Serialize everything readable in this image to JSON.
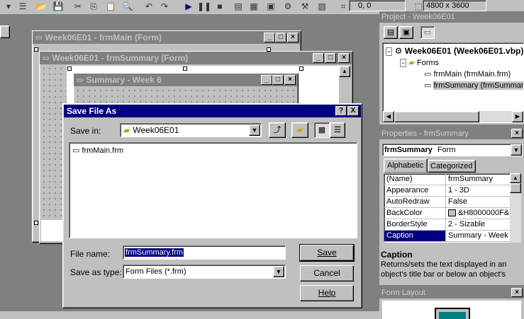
{
  "toolbar": {
    "coords": "0, 0",
    "size": "4800 x 3600"
  },
  "forms": {
    "main_title": "Week06E01 - frmMain (Form)",
    "summary_title": "Week06E01 - frmSummary (Form)",
    "inner_title": "Summary - Week 6"
  },
  "dialog": {
    "title": "Save File As",
    "save_in_label": "Save in:",
    "save_in_value": "Week06E01",
    "files": [
      "frmMain.frm"
    ],
    "file_name_label": "File name:",
    "file_name_value": "frmSummary.frm",
    "save_type_label": "Save as type:",
    "save_type_value": "Form Files (*.frm)",
    "save_button": "Save",
    "cancel_button": "Cancel",
    "help_button": "Help",
    "help_icon": "?",
    "close_icon": "X"
  },
  "project": {
    "title": "Project - Week06E01",
    "root": "Week06E01 (Week06E01.vbp)",
    "folder": "Forms",
    "items": [
      "frmMain (frmMain.frm)",
      "frmSummary (frmSummary.frm)"
    ]
  },
  "properties": {
    "title": "Properties - frmSummary",
    "object_name": "frmSummary",
    "object_type": "Form",
    "tabs": [
      "Alphabetic",
      "Categorized"
    ],
    "rows": [
      {
        "name": "(Name)",
        "value": "frmSummary"
      },
      {
        "name": "Appearance",
        "value": "1 - 3D"
      },
      {
        "name": "AutoRedraw",
        "value": "False"
      },
      {
        "name": "BackColor",
        "value": "&H8000000F&"
      },
      {
        "name": "BorderStyle",
        "value": "2 - Sizable"
      },
      {
        "name": "Caption",
        "value": "Summary - Week 6"
      }
    ],
    "desc_title": "Caption",
    "desc_text": "Returns/sets the text displayed in an object's title bar or below an object's"
  },
  "form_layout": {
    "title": "Form Layout"
  }
}
